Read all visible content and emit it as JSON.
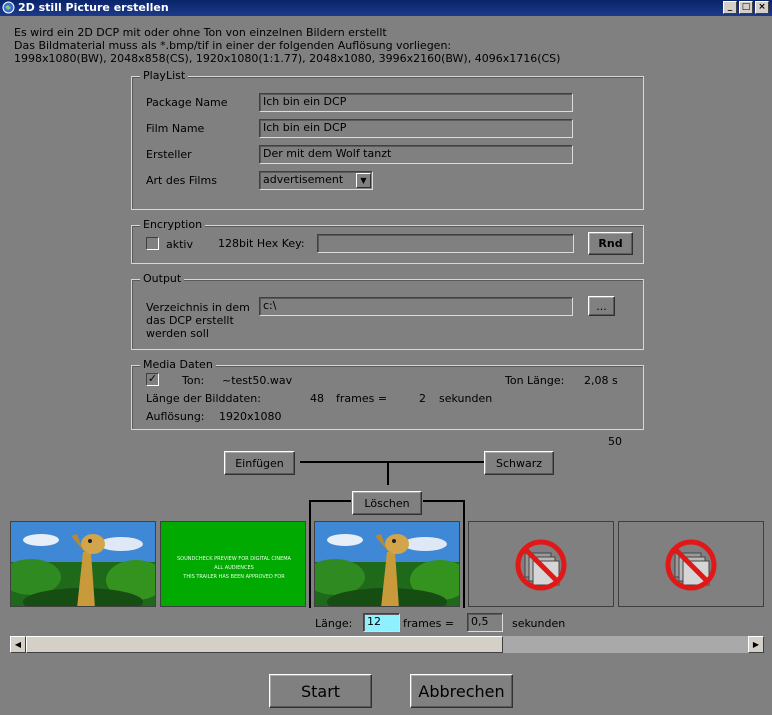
{
  "window": {
    "title": "2D still Picture erstellen",
    "minimize": "_",
    "maximize": "□",
    "close": "×"
  },
  "info": {
    "line1": "Es wird ein 2D DCP mit oder ohne Ton von einzelnen Bildern erstellt",
    "line2": "Das Bildmaterial muss als *.bmp/tif in einer der folgenden Auflösung vorliegen:",
    "line3": "1998x1080(BW), 2048x858(CS), 1920x1080(1:1.77), 2048x1080, 3996x2160(BW), 4096x1716(CS)"
  },
  "playlist": {
    "title": "PlayList",
    "package_label": "Package Name",
    "package_value": "Ich bin ein DCP",
    "film_label": "Film Name",
    "film_value": "Ich bin ein DCP",
    "creator_label": "Ersteller",
    "creator_value": "Der mit dem Wolf tanzt",
    "type_label": "Art des Films",
    "type_value": "advertisement"
  },
  "encryption": {
    "title": "Encryption",
    "active_label": "aktiv",
    "key_label": "128bit Hex Key:",
    "key_value": "",
    "rnd_button": "Rnd"
  },
  "output": {
    "title": "Output",
    "dir_label": "Verzeichnis in dem\ndas DCP erstellt\nwerden soll",
    "dir_value": "c:\\",
    "browse_button": "..."
  },
  "media": {
    "title": "Media Daten",
    "sound_label": "Ton:",
    "sound_value": "~test50.wav",
    "sound_length_label": "Ton Länge:",
    "sound_length_value": "2,08 s",
    "image_length_label": "Länge der Bilddaten:",
    "image_frames": "48",
    "frames_eq": "frames =",
    "image_seconds": "2",
    "seconds_label": "sekunden",
    "resolution_label": "Auflösung:",
    "resolution_value": "1920x1080",
    "counter": "50"
  },
  "actions": {
    "insert": "Einfügen",
    "black": "Schwarz",
    "delete": "Löschen"
  },
  "thumbs": {
    "green_text_1": "SOUNDCHECK PREVIEW FOR DIGITAL CINEMA",
    "green_text_2": "ALL AUDIENCES",
    "green_text_3": "THIS TRAILER HAS BEEN APPROVED FOR"
  },
  "length": {
    "label": "Länge:",
    "frames_value": "12",
    "frames_label": "frames =",
    "seconds_value": "0,5",
    "seconds_label": "sekunden"
  },
  "buttons": {
    "start": "Start",
    "cancel": "Abbrechen"
  },
  "scroll": {
    "position_fraction": 0.66
  },
  "colors": {
    "titlebar": "#0a246a",
    "background": "#808080",
    "green": "#00aa00",
    "input_highlight": "#8ff0ff",
    "no_image_red": "#e01818"
  }
}
